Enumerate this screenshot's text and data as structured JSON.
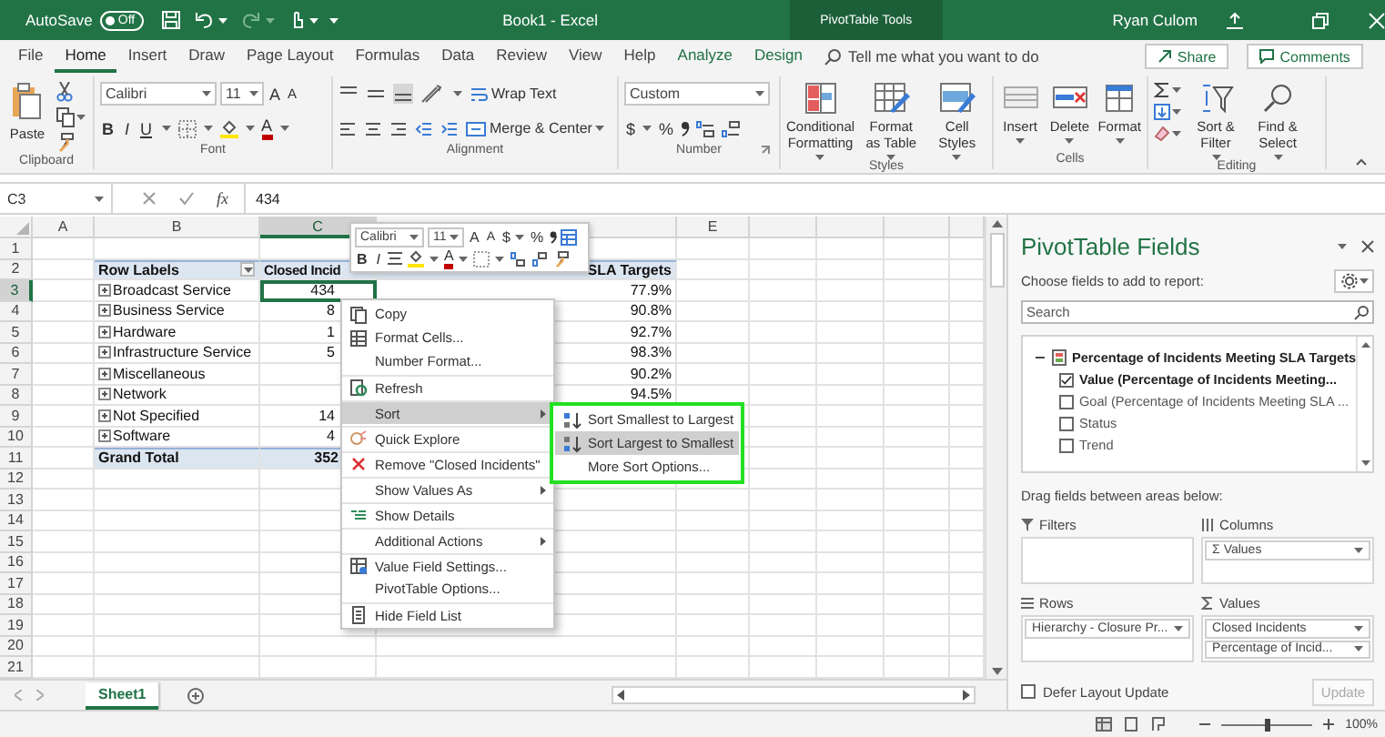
{
  "title_bar": {
    "autosave_label": "AutoSave",
    "autosave_on": false,
    "autosave_state": "Off",
    "document_title": "Book1 - Excel",
    "contextual_tab": "PivotTable Tools",
    "user_name": "Ryan Culom"
  },
  "ribbon_tabs": [
    {
      "label": "File",
      "selected": false,
      "contextual": false
    },
    {
      "label": "Home",
      "selected": true,
      "contextual": false
    },
    {
      "label": "Insert",
      "selected": false,
      "contextual": false
    },
    {
      "label": "Draw",
      "selected": false,
      "contextual": false
    },
    {
      "label": "Page Layout",
      "selected": false,
      "contextual": false
    },
    {
      "label": "Formulas",
      "selected": false,
      "contextual": false
    },
    {
      "label": "Data",
      "selected": false,
      "contextual": false
    },
    {
      "label": "Review",
      "selected": false,
      "contextual": false
    },
    {
      "label": "View",
      "selected": false,
      "contextual": false
    },
    {
      "label": "Help",
      "selected": false,
      "contextual": false
    },
    {
      "label": "Analyze",
      "selected": false,
      "contextual": true
    },
    {
      "label": "Design",
      "selected": false,
      "contextual": true
    }
  ],
  "tell_me": {
    "placeholder": "Tell me what you want to do"
  },
  "share": "Share",
  "comments": "Comments",
  "ribbon": {
    "clipboard": {
      "label": "Clipboard",
      "paste": "Paste"
    },
    "font": {
      "label": "Font",
      "font_name": "Calibri",
      "font_size": "11",
      "grow_font": "A",
      "shrink_font": "A",
      "bold": "B",
      "italic": "I",
      "underline": "U",
      "font_color": "A"
    },
    "alignment": {
      "label": "Alignment",
      "wrap_text": "Wrap Text",
      "merge": "Merge & Center"
    },
    "number": {
      "label": "Number",
      "format": "Custom",
      "currency": "$",
      "percent": "%"
    },
    "styles": {
      "label": "Styles",
      "buttons": [
        {
          "label": "Conditional Formatting"
        },
        {
          "label": "Format as Table"
        },
        {
          "label": "Cell Styles"
        }
      ]
    },
    "cells": {
      "label": "Cells",
      "buttons": [
        {
          "label": "Insert"
        },
        {
          "label": "Delete"
        },
        {
          "label": "Format"
        }
      ]
    },
    "editing": {
      "label": "Editing",
      "buttons": [
        {
          "label": "Sort & Filter"
        },
        {
          "label": "Find & Select"
        }
      ]
    }
  },
  "formula_bar": {
    "name_box": "C3",
    "function_label": "fx",
    "value": "434"
  },
  "sheet": {
    "column_headers": [
      {
        "label": "A",
        "selected": false
      },
      {
        "label": "B",
        "selected": false
      },
      {
        "label": "C",
        "selected": true
      },
      {
        "label": "E",
        "selected": false
      }
    ],
    "row_numbers": [
      {
        "label": "1",
        "selected": false
      },
      {
        "label": "2",
        "selected": false
      },
      {
        "label": "3",
        "selected": true
      },
      {
        "label": "4",
        "selected": false
      },
      {
        "label": "5",
        "selected": false
      },
      {
        "label": "6",
        "selected": false
      },
      {
        "label": "7",
        "selected": false
      },
      {
        "label": "8",
        "selected": false
      },
      {
        "label": "9",
        "selected": false
      },
      {
        "label": "10",
        "selected": false
      },
      {
        "label": "11",
        "selected": false
      },
      {
        "label": "12",
        "selected": false
      },
      {
        "label": "13",
        "selected": false
      },
      {
        "label": "14",
        "selected": false
      },
      {
        "label": "15",
        "selected": false
      },
      {
        "label": "16",
        "selected": false
      },
      {
        "label": "17",
        "selected": false
      },
      {
        "label": "18",
        "selected": false
      },
      {
        "label": "19",
        "selected": false
      },
      {
        "label": "20",
        "selected": false
      },
      {
        "label": "21",
        "selected": false
      }
    ]
  },
  "pivot": {
    "header": {
      "row_labels": "Row Labels",
      "closed": "Closed Incid",
      "percentage": "SLA Targets"
    },
    "items": [
      {
        "label": "Broadcast Service",
        "closed": "434",
        "percentage": "77.9%",
        "selected": true
      },
      {
        "label": "Business Service",
        "closed": "8",
        "percentage": "90.8%",
        "selected": false
      },
      {
        "label": "Hardware",
        "closed": "1",
        "percentage": "92.7%",
        "selected": false
      },
      {
        "label": "Infrastructure Service",
        "closed": "5",
        "percentage": "98.3%",
        "selected": false
      },
      {
        "label": "Miscellaneous",
        "percentage": "90.2%",
        "selected": false
      },
      {
        "label": "Network",
        "percentage": "94.5%",
        "selected": false
      },
      {
        "label": "Not Specified",
        "closed": "14",
        "selected": false
      },
      {
        "label": "Software",
        "closed": "4",
        "selected": false
      }
    ],
    "total": {
      "label": "Grand Total",
      "closed": "352"
    }
  },
  "mini_toolbar": {
    "font_name": "Calibri",
    "font_size": "11",
    "grow_font": "A",
    "shrink_font": "A",
    "currency": "$",
    "percent": "%",
    "bold": "B",
    "italic": "I",
    "font_color": "A"
  },
  "context_menu": {
    "items": [
      {
        "label": "Copy",
        "selected": false,
        "submenu": false,
        "separator_before": false
      },
      {
        "label": "Format Cells...",
        "selected": false,
        "submenu": false,
        "separator_before": false
      },
      {
        "label": "Number Format...",
        "selected": false,
        "submenu": false,
        "separator_before": false
      },
      {
        "label": "Refresh",
        "selected": false,
        "submenu": false,
        "separator_before": true
      },
      {
        "label": "Sort",
        "selected": true,
        "submenu": true,
        "separator_before": true
      },
      {
        "label": "Quick Explore",
        "selected": false,
        "submenu": false,
        "separator_before": true
      },
      {
        "label": "Remove \"Closed Incidents\"",
        "selected": false,
        "submenu": false,
        "separator_before": true
      },
      {
        "label": "Show Values As",
        "selected": false,
        "submenu": true,
        "separator_before": true
      },
      {
        "label": "Show Details",
        "selected": false,
        "submenu": false,
        "separator_before": true
      },
      {
        "label": "Additional Actions",
        "selected": false,
        "submenu": true,
        "separator_before": true
      },
      {
        "label": "Value Field Settings...",
        "selected": false,
        "submenu": false,
        "separator_before": true
      },
      {
        "label": "PivotTable Options...",
        "selected": false,
        "submenu": false,
        "separator_before": false
      },
      {
        "label": "Hide Field List",
        "selected": false,
        "submenu": false,
        "separator_before": true
      }
    ]
  },
  "sort_submenu": {
    "annotated": true,
    "items": [
      {
        "label": "Sort Smallest to Largest",
        "selected": false
      },
      {
        "label": "Sort Largest to Smallest",
        "selected": true
      },
      {
        "label": "More Sort Options...",
        "selected": false
      }
    ]
  },
  "field_pane": {
    "title": "PivotTable Fields",
    "subtitle": "Choose fields to add to report:",
    "search": {
      "placeholder": "Search"
    },
    "fields": [
      {
        "label": "Percentage of Incidents Meeting SLA Targets",
        "kind": "table",
        "expanded": true,
        "children": [
          {
            "label": "Value (Percentage of Incidents Meeting...",
            "kind": "field",
            "checked": true
          },
          {
            "label": "Goal (Percentage of Incidents Meeting SLA ...",
            "kind": "field",
            "checked": false
          },
          {
            "label": "Status",
            "kind": "field",
            "checked": false
          },
          {
            "label": "Trend",
            "kind": "field",
            "checked": false
          }
        ]
      }
    ],
    "areas_hint": "Drag fields between areas below:",
    "areas": [
      {
        "title": "Filters"
      },
      {
        "title": "Columns",
        "items": [
          "Σ Values"
        ]
      },
      {
        "title": "Rows",
        "items": [
          "Hierarchy - Closure Pr..."
        ]
      },
      {
        "title": "Values",
        "items": [
          "Closed Incidents",
          "Percentage of Incid..."
        ]
      }
    ],
    "defer": {
      "label": "Defer Layout Update",
      "checked": false
    },
    "update_button": {
      "label": "Update",
      "disabled": true
    }
  },
  "sheet_tabs": [
    {
      "label": "Sheet1",
      "selected": true
    }
  ],
  "status_bar": {
    "zoom": {
      "reading": "100%",
      "level": 0.5
    }
  }
}
